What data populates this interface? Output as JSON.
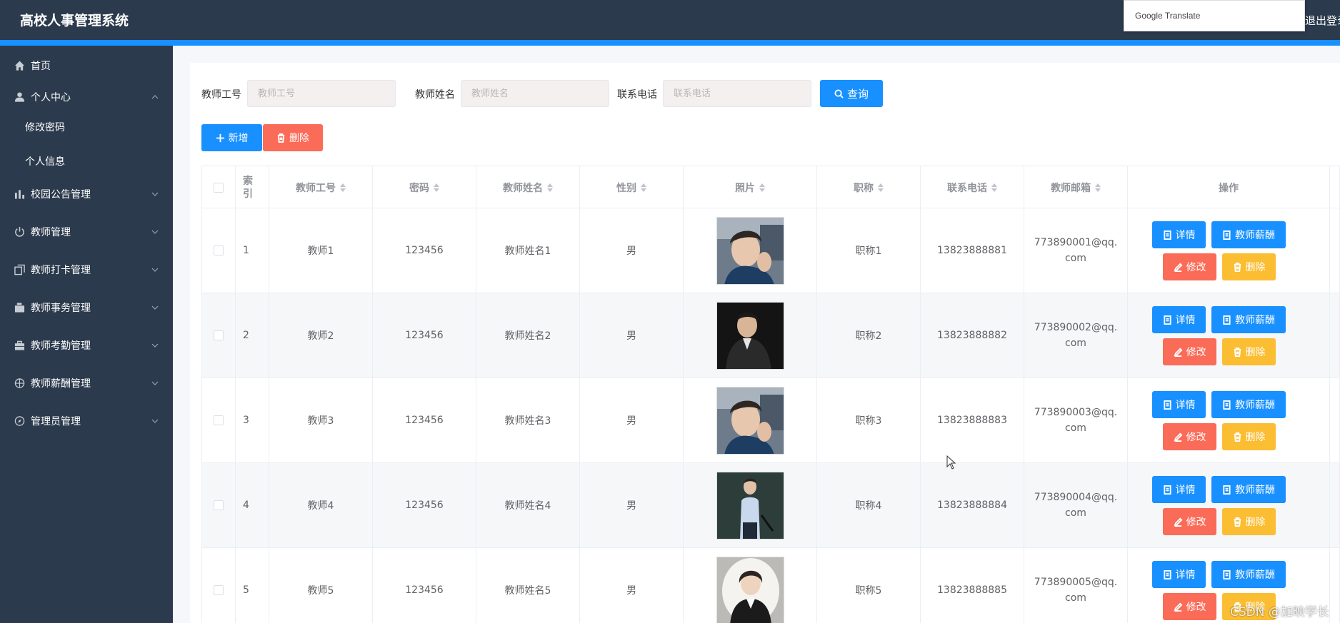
{
  "header": {
    "title": "高校人事管理系统",
    "translate_label": "Google Translate",
    "logout_label": "退出登录"
  },
  "sidebar": {
    "items": [
      {
        "label": "首页",
        "icon": "home-icon"
      },
      {
        "label": "个人中心",
        "icon": "user-icon",
        "expanded": true,
        "children": [
          {
            "label": "修改密码"
          },
          {
            "label": "个人信息"
          }
        ]
      },
      {
        "label": "校园公告管理",
        "icon": "bar-chart-icon"
      },
      {
        "label": "教师管理",
        "icon": "power-icon"
      },
      {
        "label": "教师打卡管理",
        "icon": "copy-icon"
      },
      {
        "label": "教师事务管理",
        "icon": "bank-card-icon"
      },
      {
        "label": "教师考勤管理",
        "icon": "briefcase-icon"
      },
      {
        "label": "教师薪酬管理",
        "icon": "globe-icon"
      },
      {
        "label": "管理员管理",
        "icon": "compass-icon"
      }
    ]
  },
  "search": {
    "field1": {
      "label": "教师工号",
      "placeholder": "教师工号",
      "value": ""
    },
    "field2": {
      "label": "教师姓名",
      "placeholder": "教师姓名",
      "value": ""
    },
    "field3": {
      "label": "联系电话",
      "placeholder": "联系电话",
      "value": ""
    },
    "query_label": "查询"
  },
  "actions": {
    "add_label": "新增",
    "delete_label": "删除"
  },
  "table": {
    "headers": [
      "索引",
      "教师工号",
      "密码",
      "教师姓名",
      "性别",
      "照片",
      "职称",
      "联系电话",
      "教师邮箱",
      "操作"
    ],
    "row_buttons": {
      "detail": "详情",
      "salary": "教师薪酬",
      "edit": "修改",
      "delete": "删除"
    },
    "rows": [
      {
        "index": "1",
        "no": "教师1",
        "password": "123456",
        "name": "教师姓名1",
        "gender": "男",
        "title": "职称1",
        "phone": "13823888881",
        "email": "773890001@qq.com",
        "photo": "male-portrait"
      },
      {
        "index": "2",
        "no": "教师2",
        "password": "123456",
        "name": "教师姓名2",
        "gender": "男",
        "title": "职称2",
        "phone": "13823888882",
        "email": "773890002@qq.com",
        "photo": "male-portrait-dark"
      },
      {
        "index": "3",
        "no": "教师3",
        "password": "123456",
        "name": "教师姓名3",
        "gender": "男",
        "title": "职称3",
        "phone": "13823888883",
        "email": "773890003@qq.com",
        "photo": "male-portrait"
      },
      {
        "index": "4",
        "no": "教师4",
        "password": "123456",
        "name": "教师姓名4",
        "gender": "男",
        "title": "职称4",
        "phone": "13823888884",
        "email": "773890004@qq.com",
        "photo": "male-full-body"
      },
      {
        "index": "5",
        "no": "教师5",
        "password": "123456",
        "name": "教师姓名5",
        "gender": "男",
        "title": "职称5",
        "phone": "13823888885",
        "email": "773890005@qq.com",
        "photo": "female-portrait"
      }
    ]
  },
  "watermark": "CSDN @加映学长",
  "colors": {
    "header": "#2b3a4c",
    "accent": "#1890ff",
    "danger": "#fa6b58",
    "warning": "#fbbd32"
  }
}
